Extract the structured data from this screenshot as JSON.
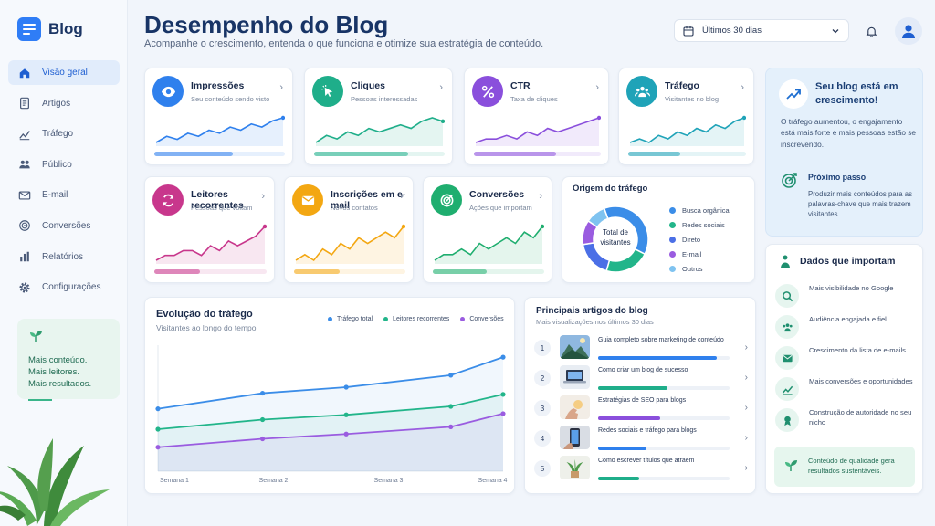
{
  "app": {
    "brand": "Blog"
  },
  "sidebar": {
    "items": [
      {
        "label": "Visão geral",
        "icon": "home-icon",
        "active": true
      },
      {
        "label": "Artigos",
        "icon": "document-icon"
      },
      {
        "label": "Tráfego",
        "icon": "trend-icon"
      },
      {
        "label": "Público",
        "icon": "people-icon"
      },
      {
        "label": "E-mail",
        "icon": "mail-icon"
      },
      {
        "label": "Conversões",
        "icon": "target-icon"
      },
      {
        "label": "Relatórios",
        "icon": "bar-chart-icon"
      },
      {
        "label": "Configurações",
        "icon": "gear-icon"
      }
    ],
    "promo": {
      "lines": [
        "Mais conteúdo.",
        "Mais leitores.",
        "Mais resultados."
      ]
    }
  },
  "header": {
    "title": "Desempenho do Blog",
    "subtitle": "Acompanhe o crescimento, entenda o que funciona e otimize sua estratégia de conteúdo.",
    "date_range": "Últimos 30 dias"
  },
  "metrics": [
    {
      "title": "Impressões",
      "subtitle": "Seu conteúdo sendo visto",
      "color": "#2f80ed",
      "icon": "eye-icon",
      "trend": [
        3,
        5,
        4,
        6,
        5,
        7,
        6,
        8,
        7,
        9,
        8,
        10,
        11
      ],
      "progress": 0.6
    },
    {
      "title": "Cliques",
      "subtitle": "Pessoas interessadas",
      "color": "#1fae8a",
      "icon": "cursor-icon",
      "trend": [
        2,
        4,
        3,
        5,
        4,
        6,
        5,
        6,
        7,
        6,
        8,
        9,
        8
      ],
      "progress": 0.72
    },
    {
      "title": "CTR",
      "subtitle": "Taxa de cliques",
      "color": "#8a4fdc",
      "icon": "percent-icon",
      "trend": [
        2,
        3,
        3,
        4,
        3,
        5,
        4,
        6,
        5,
        6,
        7,
        8,
        9
      ],
      "progress": 0.65
    },
    {
      "title": "Tráfego",
      "subtitle": "Visitantes no blog",
      "color": "#1fa3b8",
      "icon": "people-icon",
      "trend": [
        2,
        3,
        2,
        4,
        3,
        5,
        4,
        6,
        5,
        7,
        6,
        8,
        9
      ],
      "progress": 0.44
    },
    {
      "title": "Leitores recorrentes",
      "subtitle": "Pessoas que voltam",
      "color": "#c8378c",
      "icon": "refresh-icon",
      "trend": [
        2,
        3,
        3,
        4,
        4,
        3,
        5,
        4,
        6,
        5,
        6,
        7,
        9
      ],
      "progress": 0.41
    },
    {
      "title": "Inscrições em e-mail",
      "subtitle": "Novos contatos",
      "color": "#f3a712",
      "icon": "mail-icon",
      "trend": [
        3,
        4,
        3,
        5,
        4,
        6,
        5,
        7,
        6,
        7,
        8,
        7,
        9
      ],
      "progress": 0.41
    },
    {
      "title": "Conversões",
      "subtitle": "Ações que importam",
      "color": "#1fae6f",
      "icon": "target-icon",
      "trend": [
        2,
        3,
        3,
        4,
        3,
        5,
        4,
        5,
        6,
        5,
        7,
        6,
        8
      ],
      "progress": 0.48
    }
  ],
  "traffic_origin": {
    "title": "Origem do tráfego",
    "center": [
      "Total de",
      "visitantes"
    ],
    "sources": [
      {
        "label": "Busca orgânica",
        "color": "#3b8de8",
        "value": 38
      },
      {
        "label": "Redes sociais",
        "color": "#22b58a",
        "value": 22
      },
      {
        "label": "Direto",
        "color": "#4b6fe6",
        "value": 18
      },
      {
        "label": "E-mail",
        "color": "#9a5ce0",
        "value": 12
      },
      {
        "label": "Outros",
        "color": "#7fc3f0",
        "value": 10
      }
    ]
  },
  "growth": {
    "title": "Seu blog está em crescimento!",
    "text": "O tráfego aumentou, o engajamento está mais forte e mais pessoas estão se inscrevendo.",
    "next_title": "Próximo passo",
    "next_text": "Produzir mais conteúdos para as palavras-chave que mais trazem visitantes."
  },
  "data_matters": {
    "title": "Dados que importam",
    "items": [
      {
        "text": "Mais visibilidade no Google",
        "icon": "search-icon"
      },
      {
        "text": "Audiência engajada e fiel",
        "icon": "people-icon"
      },
      {
        "text": "Crescimento da lista de e-mails",
        "icon": "mail-icon"
      },
      {
        "text": "Mais conversões e oportunidades",
        "icon": "trend-icon"
      },
      {
        "text": "Construção de autoridade no seu nicho",
        "icon": "award-icon"
      }
    ],
    "footer": "Conteúdo de qualidade gera resultados sustentáveis."
  },
  "chart_data": {
    "type": "line",
    "title": "Evolução do tráfego",
    "subtitle": "Visitantes ao longo do tempo",
    "categories": [
      "Semana 1",
      "Semana 2",
      "Semana 3",
      "Semana 4"
    ],
    "x": [
      1,
      2,
      2.8,
      3.8,
      4.3
    ],
    "series": [
      {
        "name": "Tráfego total",
        "color": "#3b8de8",
        "values": [
          52,
          65,
          70,
          80,
          95
        ]
      },
      {
        "name": "Leitores recorrentes",
        "color": "#22b58a",
        "values": [
          35,
          43,
          47,
          54,
          64
        ]
      },
      {
        "name": "Conversões",
        "color": "#9a5ce0",
        "values": [
          20,
          27,
          31,
          37,
          48
        ]
      }
    ],
    "ylim": [
      0,
      105
    ],
    "grid": false,
    "legend": "top-right"
  },
  "top_articles": {
    "title": "Principais artigos do blog",
    "subtitle": "Mais visualizações nos últimos 30 dias",
    "items": [
      {
        "rank": "1",
        "name": "Guia completo sobre marketing de conteúdo",
        "progress": 0.9,
        "color": "#2f80ed",
        "thumb": "mountain"
      },
      {
        "rank": "2",
        "name": "Como criar um blog de sucesso",
        "progress": 0.53,
        "color": "#1fae8a",
        "thumb": "laptop"
      },
      {
        "rank": "3",
        "name": "Estratégias de SEO para blogs",
        "progress": 0.47,
        "color": "#8a4fdc",
        "thumb": "hand"
      },
      {
        "rank": "4",
        "name": "Redes sociais e tráfego para blogs",
        "progress": 0.37,
        "color": "#2f80ed",
        "thumb": "phone"
      },
      {
        "rank": "5",
        "name": "Como escrever títulos que atraem",
        "progress": 0.31,
        "color": "#1fae8a",
        "thumb": "plant"
      }
    ]
  }
}
